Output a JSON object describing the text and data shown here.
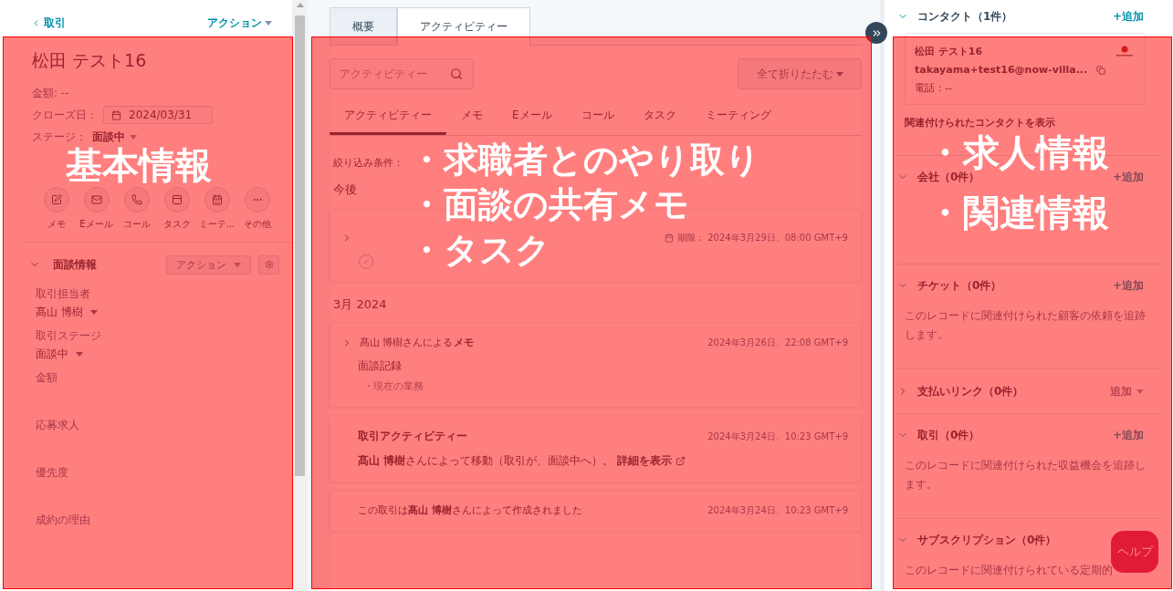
{
  "left_panel": {
    "back_link": "取引",
    "actions": "アクション",
    "record_name": "松田 テスト16",
    "fields": [
      {
        "kind": "text",
        "text": "金額: --"
      },
      {
        "kind": "date",
        "label": "クローズ日：",
        "value": "2024/03/31"
      },
      {
        "kind": "dropdown",
        "label": "ステージ：",
        "value": "面談中"
      }
    ],
    "quick_actions": [
      "メモ",
      "Eメール",
      "コール",
      "タスク",
      "ミーテ...",
      "その他"
    ],
    "section": {
      "title": "面談情報",
      "expanded": true,
      "action": "アクション",
      "properties": [
        {
          "label": "取引担当者",
          "value": "髙山 博樹"
        },
        {
          "label": "取引ステージ",
          "value": "面談中"
        },
        {
          "label": "金額"
        },
        {
          "label": "応募求人"
        },
        {
          "label": "優先度"
        },
        {
          "label": "成約の理由"
        }
      ]
    }
  },
  "center_panel": {
    "tabs": [
      {
        "label": "概要",
        "selected": false
      },
      {
        "label": "アクティビティー",
        "selected": true
      }
    ],
    "search": {
      "placeholder": "アクティビティー"
    },
    "collapse_button": "全て折りたたむ",
    "filter_tabs": [
      {
        "label": "アクティビティー",
        "selected": true
      },
      {
        "label": "メモ",
        "selected": false
      },
      {
        "label": "Eメール",
        "selected": false
      },
      {
        "label": "コール",
        "selected": false
      },
      {
        "label": "タスク",
        "selected": false
      },
      {
        "label": "ミーティング",
        "selected": false
      }
    ],
    "filter_label": "絞り込み条件：",
    "groups": [
      {
        "heading": "今後",
        "items": [
          {
            "kind": "task",
            "date": "期限： 2024年3月29日、08:00 GMT+9"
          }
        ]
      },
      {
        "heading": "3月 2024",
        "items": [
          {
            "kind": "note",
            "title": "髙山 博樹さんによる**メモ**",
            "date": "2024年3月26日、22:08 GMT+9",
            "body": "面談記録",
            "preview": "・現在の業務"
          },
          {
            "kind": "deal_activity",
            "title": "取引アクティビティー",
            "date": "2024年3月24日、10:23 GMT+9",
            "body": "**髙山 博樹**さんによって移動（取引が、面談中へ）。",
            "link": "詳細を表示"
          },
          {
            "kind": "created",
            "body": "この取引は**髙山 博樹**さんによって作成されました",
            "date": "2024年3月24日、10:23 GMT+9"
          }
        ]
      }
    ]
  },
  "right_panel": {
    "sections": [
      {
        "title": "コンタクト（1件）",
        "expanded": true,
        "add": "+追加",
        "add_disabled": false,
        "contact": {
          "name": "松田 テスト16",
          "email": "takayama+test16@now-villa...",
          "phone": "電話：--"
        },
        "link": "関連付けられたコンタクトを表示"
      },
      {
        "title": "会社（0件）",
        "expanded": true,
        "add": "+追加",
        "add_disabled": false
      },
      {
        "title": "チケット（0件）",
        "expanded": true,
        "add": "+追加",
        "add_disabled": false,
        "description": "このレコードに関連付けられた顧客の依頼を追跡します。"
      },
      {
        "title": "支払いリンク（0件）",
        "expanded": false,
        "add": "追加",
        "add_disabled": true
      },
      {
        "title": "取引（0件）",
        "expanded": true,
        "add": "+追加",
        "add_disabled": false,
        "description": "このレコードに関連付けられた収益機会を追跡します。"
      },
      {
        "title": "サブスクリプション（0件）",
        "expanded": true,
        "description": "このレコードに関連付けられている定期的"
      }
    ]
  },
  "help_button": "ヘルプ",
  "annotations": [
    {
      "lines": [
        "基本情報"
      ]
    },
    {
      "lines": [
        "・求職者とのやり取り",
        "・面談の共有メモ",
        "・タスク"
      ]
    },
    {
      "lines": [
        "・求人情報",
        "・関連情報"
      ]
    }
  ]
}
